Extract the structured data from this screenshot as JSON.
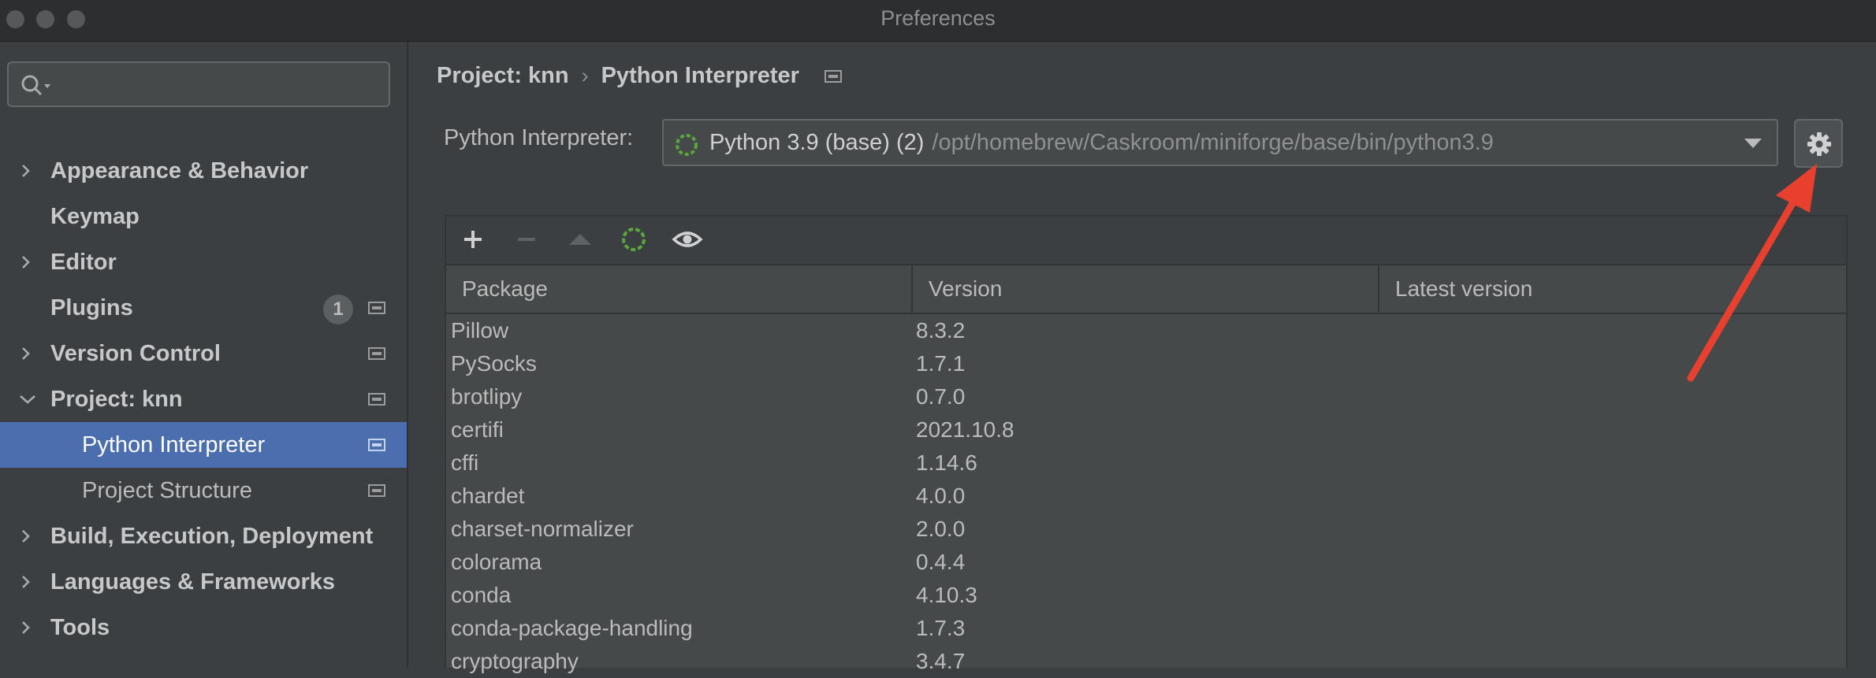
{
  "window": {
    "title": "Preferences"
  },
  "sidebar": {
    "search": {
      "placeholder": ""
    },
    "items": [
      {
        "label": "Appearance & Behavior"
      },
      {
        "label": "Keymap"
      },
      {
        "label": "Editor"
      },
      {
        "label": "Plugins",
        "badge": "1"
      },
      {
        "label": "Version Control"
      },
      {
        "label": "Project: knn"
      },
      {
        "label": "Python Interpreter"
      },
      {
        "label": "Project Structure"
      },
      {
        "label": "Build, Execution, Deployment"
      },
      {
        "label": "Languages & Frameworks"
      },
      {
        "label": "Tools"
      }
    ]
  },
  "main": {
    "breadcrumb": {
      "project": "Project: knn",
      "separator": "›",
      "page": "Python Interpreter"
    },
    "interpreter": {
      "label": "Python Interpreter:",
      "name": "Python 3.9 (base) (2)",
      "path": "/opt/homebrew/Caskroom/miniforge/base/bin/python3.9"
    },
    "table": {
      "columns": [
        "Package",
        "Version",
        "Latest version"
      ],
      "rows": [
        {
          "package": "Pillow",
          "version": "8.3.2"
        },
        {
          "package": "PySocks",
          "version": "1.7.1"
        },
        {
          "package": "brotlipy",
          "version": "0.7.0"
        },
        {
          "package": "certifi",
          "version": "2021.10.8"
        },
        {
          "package": "cffi",
          "version": "1.14.6"
        },
        {
          "package": "chardet",
          "version": "4.0.0"
        },
        {
          "package": "charset-normalizer",
          "version": "2.0.0"
        },
        {
          "package": "colorama",
          "version": "0.4.4"
        },
        {
          "package": "conda",
          "version": "4.10.3"
        },
        {
          "package": "conda-package-handling",
          "version": "1.7.3"
        },
        {
          "package": "cryptography",
          "version": "3.4.7"
        }
      ]
    }
  },
  "colors": {
    "selection": "#4b6eaf",
    "annotation_arrow": "#e8402e",
    "spinner": "#5ba63e"
  },
  "icons": {
    "toolbar": [
      "plus-icon",
      "minus-icon",
      "up-arrow-icon",
      "loading-spinner-icon",
      "eye-icon"
    ],
    "settings": "gear-icon"
  }
}
